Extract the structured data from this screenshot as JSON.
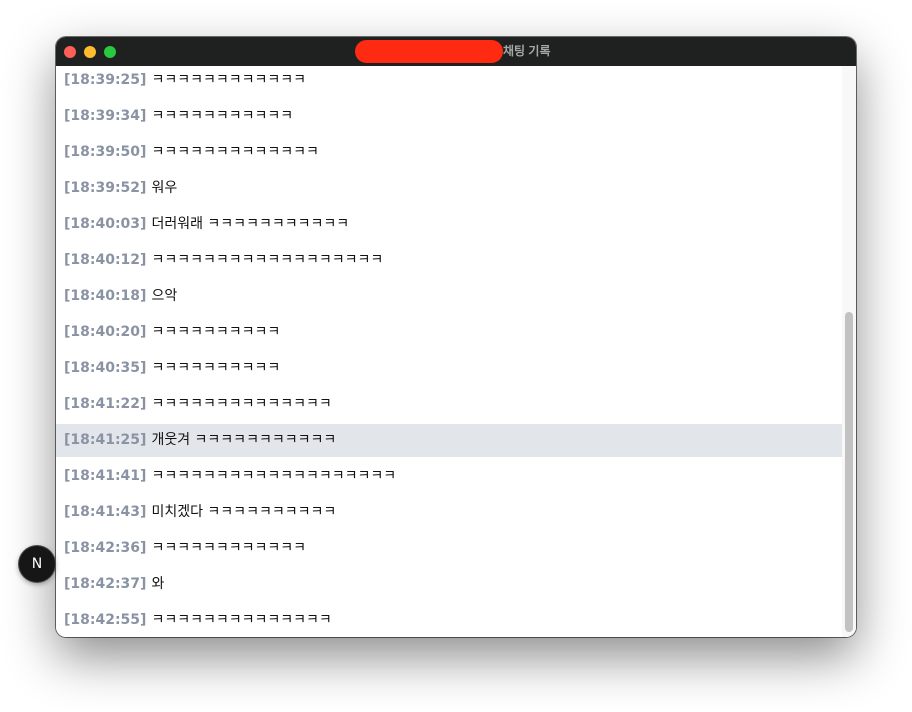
{
  "window": {
    "title": "채팅 기록",
    "colors": {
      "close": "#fe5f57",
      "minimize": "#febc2e",
      "maximize": "#28c840",
      "redaction": "#ff2a12",
      "scroll_thumb": "#c2c2c2",
      "highlight": "#e2e5ea",
      "timestamp": "#8a93a3"
    }
  },
  "messages": [
    {
      "time": "[18:39:25]",
      "text": "ㅋㅋㅋㅋㅋㅋㅋㅋㅋㅋㅋㅋ"
    },
    {
      "time": "[18:39:34]",
      "text": "ㅋㅋㅋㅋㅋㅋㅋㅋㅋㅋㅋ"
    },
    {
      "time": "[18:39:50]",
      "text": "ㅋㅋㅋㅋㅋㅋㅋㅋㅋㅋㅋㅋㅋ"
    },
    {
      "time": "[18:39:52]",
      "text": "워우"
    },
    {
      "time": "[18:40:03]",
      "text": "더러워래 ㅋㅋㅋㅋㅋㅋㅋㅋㅋㅋㅋ"
    },
    {
      "time": "[18:40:12]",
      "text": "ㅋㅋㅋㅋㅋㅋㅋㅋㅋㅋㅋㅋㅋㅋㅋㅋㅋㅋ"
    },
    {
      "time": "[18:40:18]",
      "text": "으악"
    },
    {
      "time": "[18:40:20]",
      "text": "ㅋㅋㅋㅋㅋㅋㅋㅋㅋㅋ"
    },
    {
      "time": "[18:40:35]",
      "text": "ㅋㅋㅋㅋㅋㅋㅋㅋㅋㅋ"
    },
    {
      "time": "[18:41:22]",
      "text": "ㅋㅋㅋㅋㅋㅋㅋㅋㅋㅋㅋㅋㅋㅋ"
    },
    {
      "time": "[18:41:25]",
      "text": "개웃겨 ㅋㅋㅋㅋㅋㅋㅋㅋㅋㅋㅋ"
    },
    {
      "time": "[18:41:41]",
      "text": "ㅋㅋㅋㅋㅋㅋㅋㅋㅋㅋㅋㅋㅋㅋㅋㅋㅋㅋㅋ"
    },
    {
      "time": "[18:41:43]",
      "text": "미치겠다 ㅋㅋㅋㅋㅋㅋㅋㅋㅋㅋ"
    },
    {
      "time": "[18:42:36]",
      "text": "ㅋㅋㅋㅋㅋㅋㅋㅋㅋㅋㅋㅋ"
    },
    {
      "time": "[18:42:37]",
      "text": "와"
    },
    {
      "time": "[18:42:55]",
      "text": "ㅋㅋㅋㅋㅋㅋㅋㅋㅋㅋㅋㅋㅋㅋ"
    }
  ],
  "highlighted_message": 10,
  "badge": {
    "label": "N"
  }
}
